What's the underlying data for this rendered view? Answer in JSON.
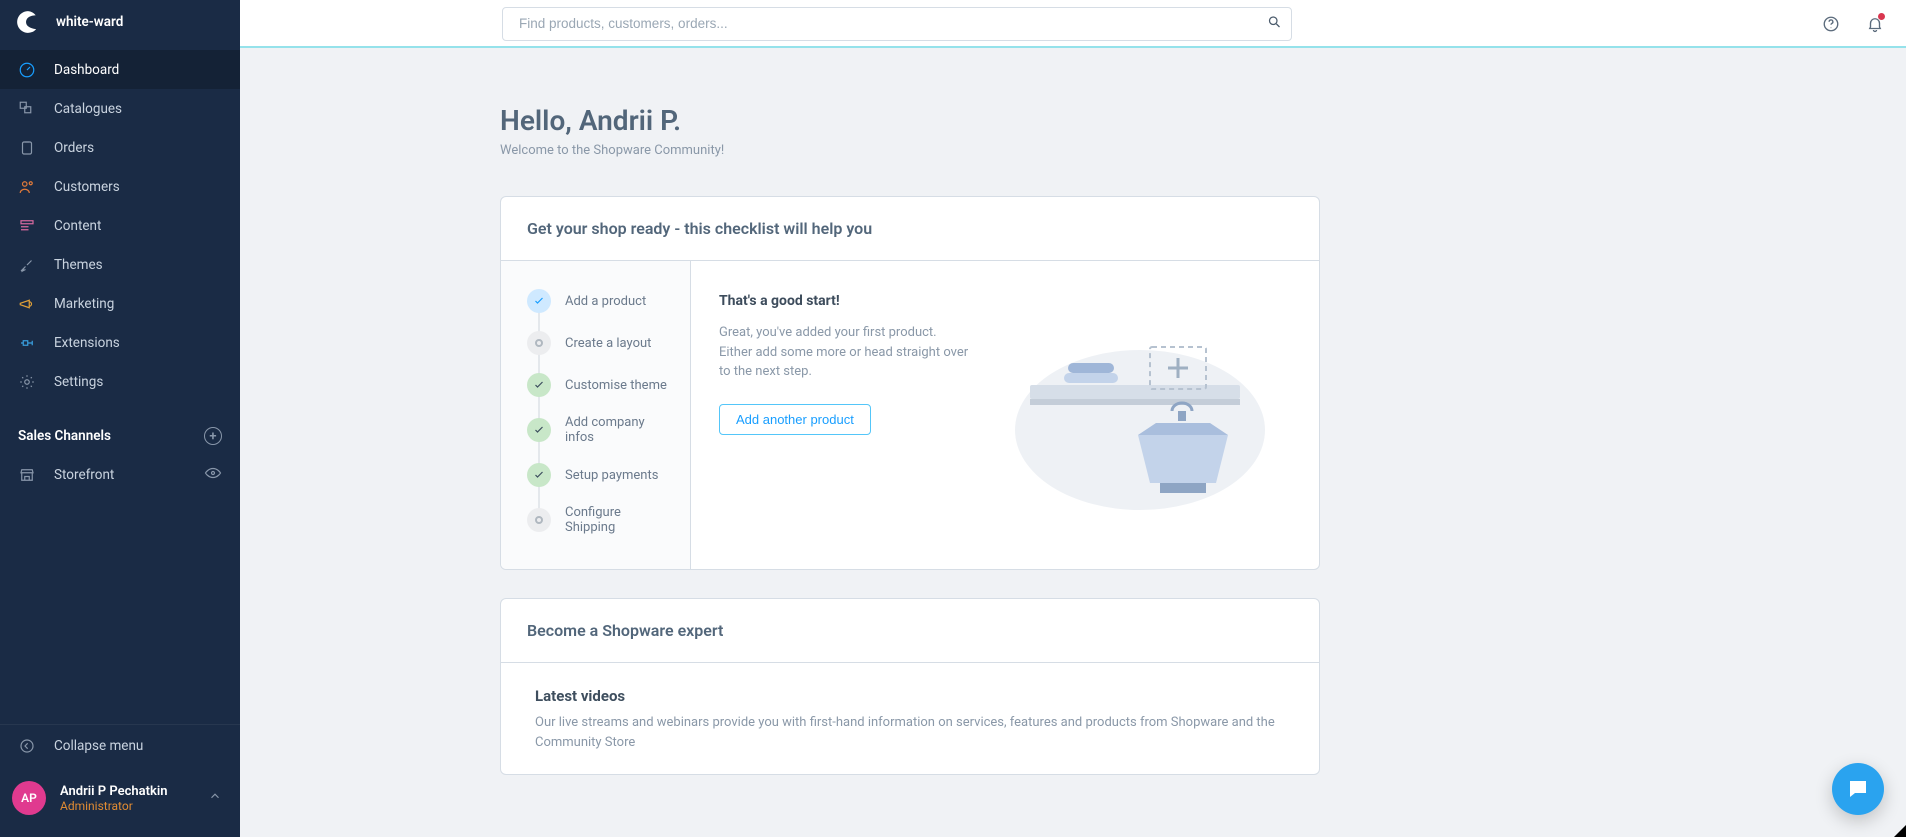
{
  "brand": "white-ward",
  "nav": {
    "items": [
      {
        "label": "Dashboard",
        "icon": "gauge"
      },
      {
        "label": "Catalogues",
        "icon": "boxes"
      },
      {
        "label": "Orders",
        "icon": "clipboard"
      },
      {
        "label": "Customers",
        "icon": "users"
      },
      {
        "label": "Content",
        "icon": "layout"
      },
      {
        "label": "Themes",
        "icon": "brush"
      },
      {
        "label": "Marketing",
        "icon": "megaphone"
      },
      {
        "label": "Extensions",
        "icon": "plug"
      },
      {
        "label": "Settings",
        "icon": "gear"
      }
    ],
    "active_index": 0
  },
  "sales_channels": {
    "heading": "Sales Channels",
    "items": [
      {
        "label": "Storefront"
      }
    ]
  },
  "collapse_label": "Collapse menu",
  "user": {
    "initials": "AP",
    "name": "Andrii P Pechatkin",
    "role": "Administrator"
  },
  "search": {
    "placeholder": "Find products, customers, orders..."
  },
  "page": {
    "hello": "Hello, Andrii P.",
    "welcome": "Welcome to the Shopware Community!"
  },
  "checklist_card": {
    "title": "Get your shop ready - this checklist will help you",
    "steps": [
      {
        "label": "Add a product",
        "state": "done-blue"
      },
      {
        "label": "Create a layout",
        "state": "pending"
      },
      {
        "label": "Customise theme",
        "state": "done-green"
      },
      {
        "label": "Add company infos",
        "state": "done-green"
      },
      {
        "label": "Setup payments",
        "state": "done-green"
      },
      {
        "label": "Configure Shipping",
        "state": "pending"
      }
    ],
    "message": {
      "title": "That's a good start!",
      "body": "Great, you've added your first product. Either add some more or head straight over to the next step.",
      "button": "Add another product"
    }
  },
  "expert_card": {
    "title": "Become a Shopware expert",
    "sub": "Latest videos",
    "desc": "Our live streams and webinars provide you with first-hand information on services, features and products from Shopware and the Community Store"
  }
}
